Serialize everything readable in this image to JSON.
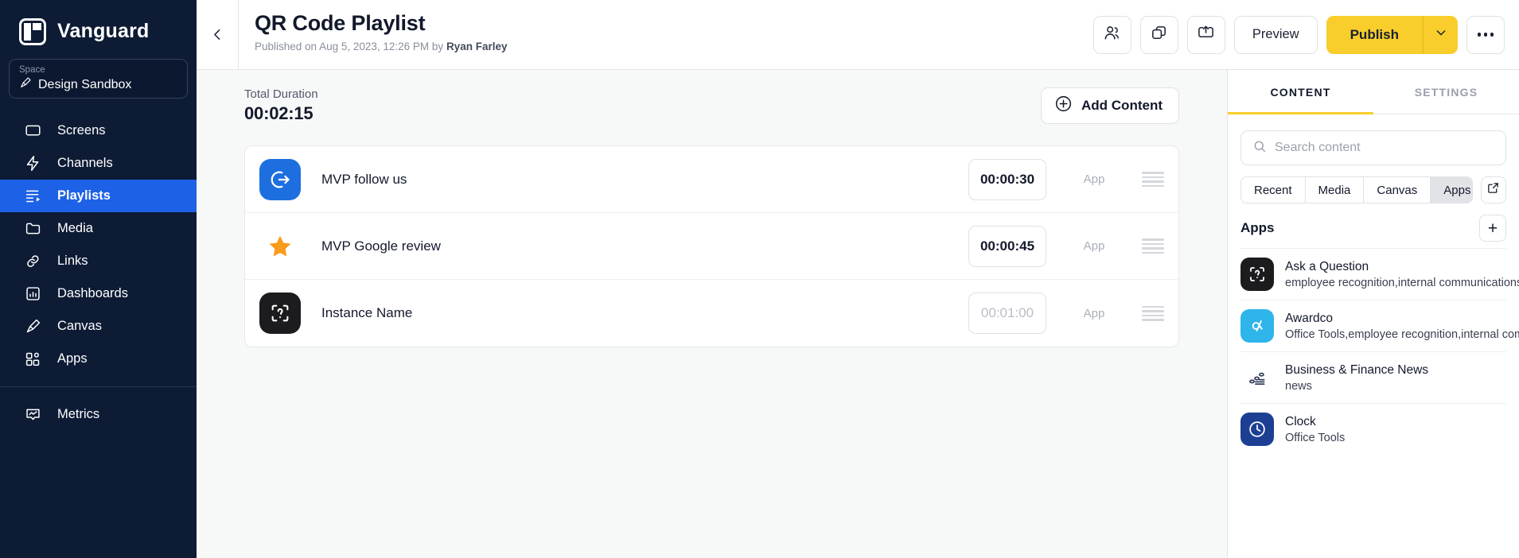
{
  "sidebar": {
    "brand": "Vanguard",
    "space_label": "Space",
    "space_value": "Design Sandbox",
    "items": [
      {
        "label": "Screens",
        "icon": "monitor-icon"
      },
      {
        "label": "Channels",
        "icon": "bolt-icon"
      },
      {
        "label": "Playlists",
        "icon": "playlist-icon"
      },
      {
        "label": "Media",
        "icon": "folder-icon"
      },
      {
        "label": "Links",
        "icon": "link-icon"
      },
      {
        "label": "Dashboards",
        "icon": "chart-icon"
      },
      {
        "label": "Canvas",
        "icon": "brush-icon"
      },
      {
        "label": "Apps",
        "icon": "apps-icon"
      }
    ],
    "footer_item": {
      "label": "Metrics",
      "icon": "metrics-icon"
    }
  },
  "header": {
    "title": "QR Code Playlist",
    "published_prefix": "Published on Aug 5, 2023, 12:26 PM by ",
    "published_author": "Ryan Farley",
    "preview_label": "Preview",
    "publish_label": "Publish"
  },
  "center": {
    "duration_label": "Total Duration",
    "duration_value": "00:02:15",
    "add_content_label": "Add Content",
    "rows": [
      {
        "name": "MVP follow us",
        "time": "00:00:30",
        "type": "App",
        "icon": "exit-arrow-icon",
        "icon_style": "blue",
        "placeholder": false
      },
      {
        "name": "MVP Google review",
        "time": "00:00:45",
        "type": "App",
        "icon": "star-icon",
        "icon_style": "plain",
        "placeholder": false
      },
      {
        "name": "Instance Name",
        "time": "00:01:00",
        "type": "App",
        "icon": "qr-question-icon",
        "icon_style": "dark",
        "placeholder": true
      }
    ]
  },
  "right_panel": {
    "tabs": [
      {
        "label": "CONTENT",
        "active": true
      },
      {
        "label": "SETTINGS",
        "active": false
      }
    ],
    "search_placeholder": "Search content",
    "search_value": "",
    "filters": [
      {
        "label": "Recent",
        "active": false
      },
      {
        "label": "Media",
        "active": false
      },
      {
        "label": "Canvas",
        "active": false
      },
      {
        "label": "Apps",
        "active": true
      }
    ],
    "section_title": "Apps",
    "add_symbol": "+",
    "apps": [
      {
        "title": "Ask a Question",
        "subtitle": "employee recognition,internal communications,",
        "icon": "qr-question-icon",
        "icon_style": "dark"
      },
      {
        "title": "Awardco",
        "subtitle": "Office Tools,employee recognition,internal comm",
        "icon": "awardco-icon",
        "icon_style": "cyan"
      },
      {
        "title": "Business & Finance News",
        "subtitle": "news",
        "icon": "finance-news-icon",
        "icon_style": "none"
      },
      {
        "title": "Clock",
        "subtitle": "Office Tools",
        "icon": "clock-icon",
        "icon_style": "navy"
      }
    ]
  },
  "colors": {
    "sidebar_bg": "#0D1B35",
    "active_nav": "#1D61E7",
    "accent_yellow": "#F8CD2C",
    "canvas_bg": "#F7F8F8"
  }
}
